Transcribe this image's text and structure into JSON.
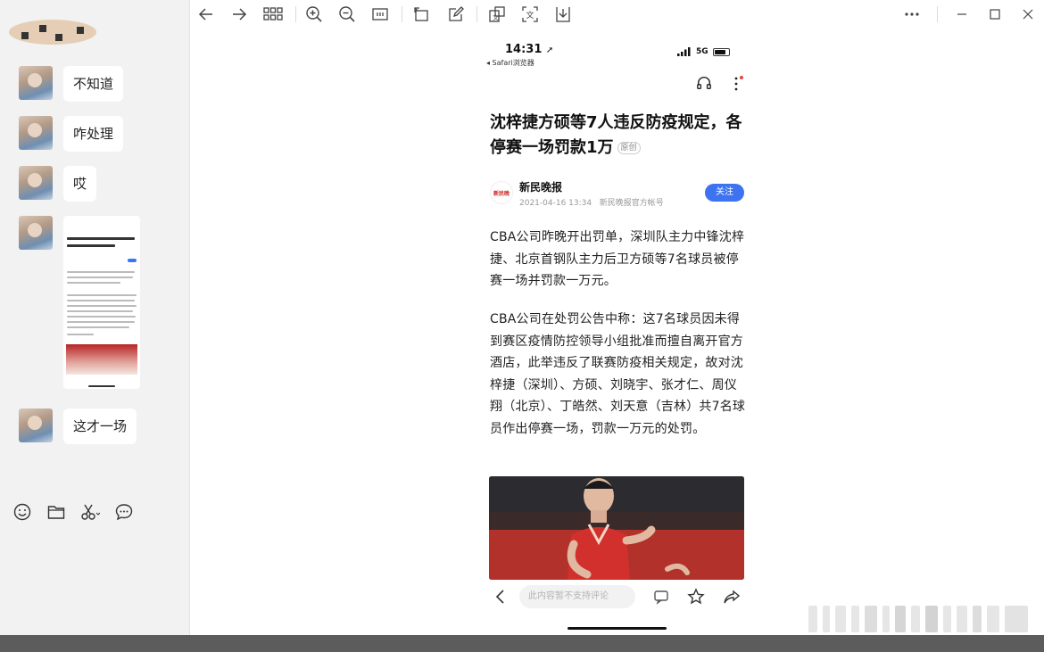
{
  "chat": {
    "messages": [
      {
        "text": "不知道"
      },
      {
        "text": "咋处理"
      },
      {
        "text": "哎"
      },
      {
        "text": ""
      },
      {
        "text": "这才一场"
      }
    ],
    "tools": [
      "emoji-icon",
      "folder-icon",
      "scissors-icon",
      "chat-bubble-icon"
    ]
  },
  "toolbar": {
    "icons": [
      "back-arrow-icon",
      "forward-arrow-icon",
      "grid-icon",
      "zoom-in-icon",
      "zoom-out-icon",
      "fit-width-icon",
      "rotate-icon",
      "edit-icon",
      "extract-text-icon",
      "ocr-icon",
      "download-icon",
      "more-icon",
      "minimize-icon",
      "maximize-icon",
      "close-icon"
    ]
  },
  "phone": {
    "time": "14:31",
    "back_app": "◂ Safari浏览器",
    "network": "5G",
    "title": "沈梓捷方硕等7人违反防疫规定，各停赛一场罚款1万",
    "original_tag": "原创",
    "author": "新民晚报",
    "author_logo_text": "新民晚",
    "timestamp": "2021-04-16 13:34",
    "account_type": "新民晚报官方帐号",
    "follow_label": "关注",
    "paragraph1": "CBA公司昨晚开出罚单，深圳队主力中锋沈梓捷、北京首钢队主力后卫方硕等7名球员被停赛一场并罚款一万元。",
    "paragraph2": "CBA公司在处罚公告中称：这7名球员因未得到赛区疫情防控领导小组批准而擅自离开官方酒店，此举违反了联赛防疫相关规定，故对沈梓捷（深圳）、方硕、刘晓宇、张才仁、周仪翔（北京）、丁皓然、刘天意（吉林）共7名球员作出停赛一场，罚款一万元的处罚。",
    "comment_placeholder": "此内容暂不支持评论"
  },
  "colors": {
    "accent": "#3d72f0",
    "chat_bg": "#f2f2f3",
    "taskbar": "#5c5c5c"
  }
}
